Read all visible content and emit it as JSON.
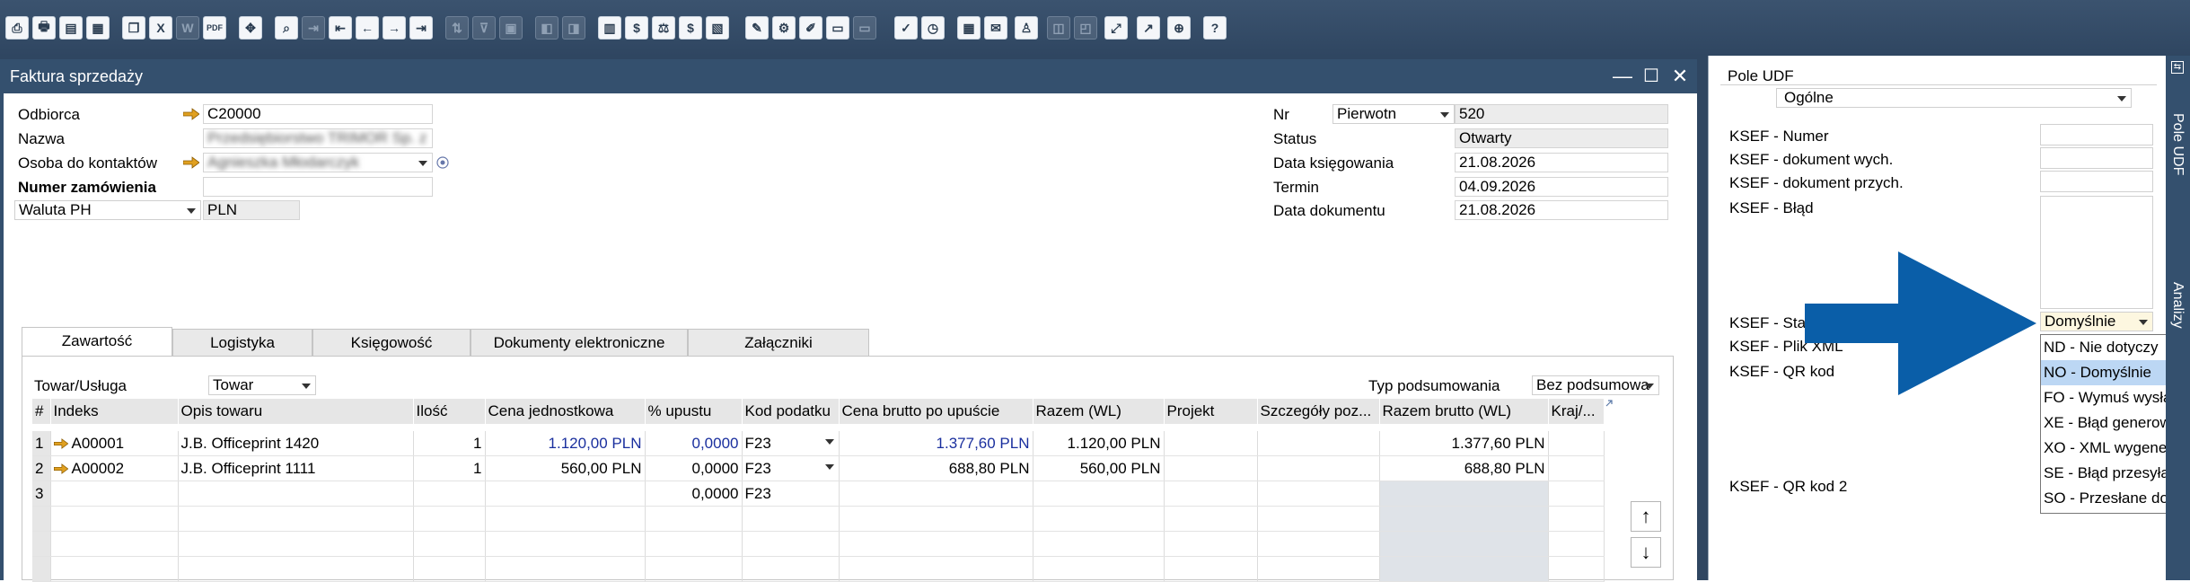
{
  "window": {
    "title": "Faktura sprzedaży"
  },
  "header_left": {
    "odbiorca_label": "Odbiorca",
    "odbiorca_value": "C20000",
    "nazwa_label": "Nazwa",
    "nazwa_value": "Przedsiębiorstwo TRIMOR Sp. z",
    "osoba_label": "Osoba do kontaktów",
    "osoba_value": "Agnieszka Młodarczyk",
    "numer_label": "Numer zamówienia",
    "waluta_label": "Waluta PH",
    "waluta_value": "PLN"
  },
  "header_right": {
    "nr_label": "Nr",
    "nr_series": "Pierwotn",
    "nr_value": "520",
    "status_label": "Status",
    "status_value": "Otwarty",
    "data_ksieg_label": "Data księgowania",
    "data_ksieg_value": "21.08.2026",
    "termin_label": "Termin",
    "termin_value": "04.09.2026",
    "data_dok_label": "Data dokumentu",
    "data_dok_value": "21.08.2026"
  },
  "tabs": [
    {
      "label": "Zawartość",
      "active": true
    },
    {
      "label": "Logistyka",
      "active": false
    },
    {
      "label": "Księgowość",
      "active": false
    },
    {
      "label": "Dokumenty elektroniczne",
      "active": false
    },
    {
      "label": "Załączniki",
      "active": false
    }
  ],
  "content": {
    "item_type_label": "Towar/Usługa",
    "item_type_value": "Towar",
    "summary_label": "Typ podsumowania",
    "summary_value": "Bez podsumowa"
  },
  "grid": {
    "columns": [
      "#",
      "Indeks",
      "Opis towaru",
      "Ilość",
      "Cena jednostkowa",
      "% upustu",
      "Kod podatku",
      "Cena brutto po upuście",
      "Razem (WL)",
      "Projekt",
      "Szczegóły poz...",
      "Razem brutto (WL)",
      "Kraj/..."
    ],
    "rows": [
      {
        "num": "1",
        "index": "A00001",
        "desc": "J.B. Officeprint 1420",
        "qty": "1",
        "unit_price": "1.120,00 PLN",
        "discount": "0,0000",
        "tax": "F23",
        "gross_after": "1.377,60 PLN",
        "total": "1.120,00 PLN",
        "project": "",
        "details": "",
        "gross_total": "1.377,60 PLN",
        "country": ""
      },
      {
        "num": "2",
        "index": "A00002",
        "desc": "J.B. Officeprint 1111",
        "qty": "1",
        "unit_price": "560,00 PLN",
        "discount": "0,0000",
        "tax": "F23",
        "gross_after": "688,80 PLN",
        "total": "560,00 PLN",
        "project": "",
        "details": "",
        "gross_total": "688,80 PLN",
        "country": ""
      },
      {
        "num": "3",
        "index": "",
        "desc": "",
        "qty": "",
        "unit_price": "",
        "discount": "0,0000",
        "tax": "F23",
        "gross_after": "",
        "total": "",
        "project": "",
        "details": "",
        "gross_total": "",
        "country": ""
      }
    ]
  },
  "udf": {
    "title": "Pole UDF",
    "category": "Ogólne",
    "ksef_numer": "KSEF - Numer",
    "ksef_dok_wych": "KSEF - dokument wych.",
    "ksef_dok_przych": "KSEF - dokument przych.",
    "ksef_blad": "KSEF - Błąd",
    "ksef_status": "KSEF - Status",
    "ksef_plik": "KSEF - Plik XML",
    "ksef_qr": "KSEF -  QR kod",
    "ksef_qr2": "KSEF -  QR kod 2",
    "status_value": "Domyślnie",
    "status_options": [
      "ND - Nie dotyczy",
      "NO - Domyślnie",
      "FO - Wymuś wysłanie",
      "XE - Błąd generowania",
      "XO - XML wygenerowany",
      "SE - Błąd przesyłania",
      "SO - Przesłane do KSeF"
    ],
    "side_tab_udf": "Pole UDF",
    "side_tab_analyze": "Analizy"
  },
  "colors": {
    "accent": "#34506e",
    "toolbar": "#2f4661",
    "arrow": "#0a5ea8",
    "link_arrow": "#e0a020"
  }
}
